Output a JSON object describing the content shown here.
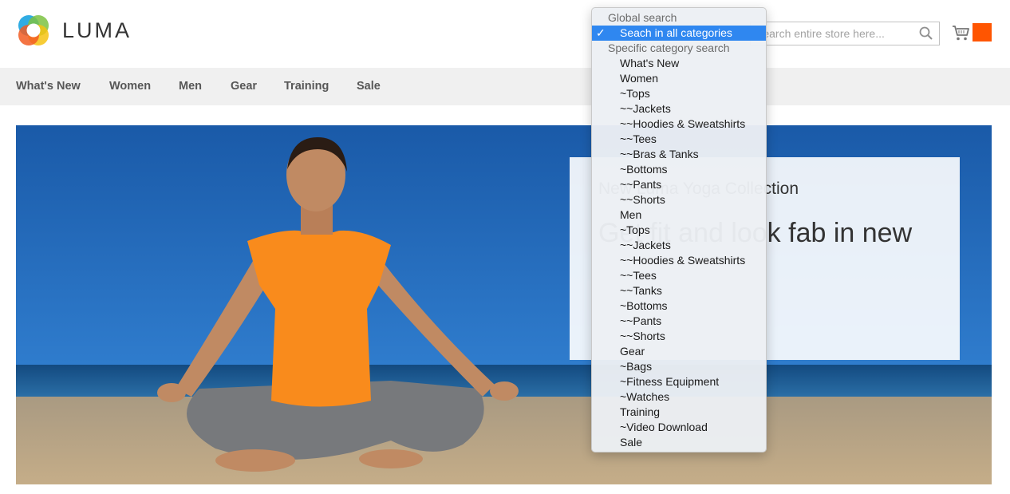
{
  "brand": {
    "name": "LUMA"
  },
  "search": {
    "placeholder": "Search entire store here...",
    "value": ""
  },
  "nav": {
    "items": [
      "What's New",
      "Women",
      "Men",
      "Gear",
      "Training",
      "Sale"
    ]
  },
  "hero": {
    "eyebrow": "New Luma Yoga Collection",
    "headline": "Get fit and look fab in new"
  },
  "dropdown": {
    "groups": [
      {
        "label": "Global search",
        "options": [
          {
            "label": "Seach in all categories",
            "selected": true,
            "check": "✓"
          }
        ]
      },
      {
        "label": "Specific category search",
        "options": [
          {
            "label": "What's New"
          },
          {
            "label": "Women"
          },
          {
            "label": "~Tops"
          },
          {
            "label": "~~Jackets"
          },
          {
            "label": "~~Hoodies & Sweatshirts"
          },
          {
            "label": "~~Tees"
          },
          {
            "label": "~~Bras & Tanks"
          },
          {
            "label": "~Bottoms"
          },
          {
            "label": "~~Pants"
          },
          {
            "label": "~~Shorts"
          },
          {
            "label": "Men"
          },
          {
            "label": "~Tops"
          },
          {
            "label": "~~Jackets"
          },
          {
            "label": "~~Hoodies & Sweatshirts"
          },
          {
            "label": "~~Tees"
          },
          {
            "label": "~~Tanks"
          },
          {
            "label": "~Bottoms"
          },
          {
            "label": "~~Pants"
          },
          {
            "label": "~~Shorts"
          },
          {
            "label": "Gear"
          },
          {
            "label": "~Bags"
          },
          {
            "label": "~Fitness Equipment"
          },
          {
            "label": "~Watches"
          },
          {
            "label": "Training"
          },
          {
            "label": "~Video Download"
          },
          {
            "label": "Sale"
          }
        ]
      }
    ]
  },
  "colors": {
    "accent": "#ff5501",
    "selected_option": "#2f87f0",
    "nav_bg": "#f0f0f0",
    "sky": "#1d5ea8",
    "sand": "#c9b28e",
    "shirt": "#f98b1c"
  },
  "icons": {
    "search": "search-icon",
    "cart": "cart-icon",
    "check": "checkmark-icon"
  }
}
